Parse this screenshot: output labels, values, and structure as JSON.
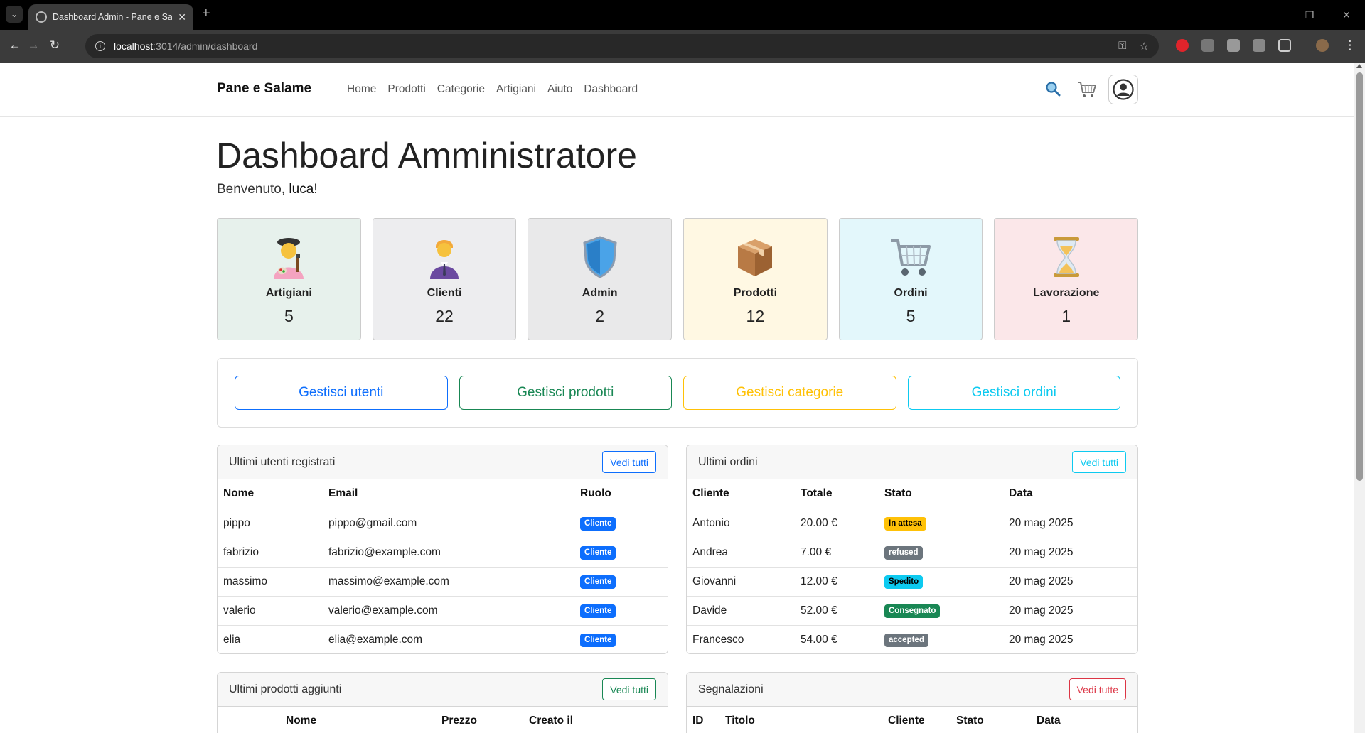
{
  "browser": {
    "tab_title": "Dashboard Admin - Pane e Salame",
    "url_host": "localhost",
    "url_path": ":3014/admin/dashboard"
  },
  "nav": {
    "brand": "Pane e Salame",
    "links": [
      "Home",
      "Prodotti",
      "Categorie",
      "Artigiani",
      "Aiuto",
      "Dashboard"
    ]
  },
  "page": {
    "title": "Dashboard Amministratore",
    "welcome_prefix": "Benvenuto, ",
    "username": "luca",
    "welcome_suffix": "!"
  },
  "stats": [
    {
      "label": "Artigiani",
      "value": "5",
      "icon": "artist-icon",
      "bg": "#e7f1ec"
    },
    {
      "label": "Clienti",
      "value": "22",
      "icon": "person-icon",
      "bg": "#ededef"
    },
    {
      "label": "Admin",
      "value": "2",
      "icon": "shield-icon",
      "bg": "#e9e9ea"
    },
    {
      "label": "Prodotti",
      "value": "12",
      "icon": "package-icon",
      "bg": "#fff8e3"
    },
    {
      "label": "Ordini",
      "value": "5",
      "icon": "cart-icon",
      "bg": "#e3f7fb"
    },
    {
      "label": "Lavorazione",
      "value": "1",
      "icon": "hourglass-icon",
      "bg": "#fbe7e9"
    }
  ],
  "actions": [
    {
      "label": "Gestisci utenti",
      "color": "#0d6efd"
    },
    {
      "label": "Gestisci prodotti",
      "color": "#198754"
    },
    {
      "label": "Gestisci categorie",
      "color": "#ffc107"
    },
    {
      "label": "Gestisci ordini",
      "color": "#0dcaf0"
    }
  ],
  "users_card": {
    "title": "Ultimi utenti registrati",
    "button": "Vedi tutti",
    "columns": [
      "Nome",
      "Email",
      "Ruolo"
    ],
    "rows": [
      [
        "pippo",
        "pippo@gmail.com",
        "Cliente"
      ],
      [
        "fabrizio",
        "fabrizio@example.com",
        "Cliente"
      ],
      [
        "massimo",
        "massimo@example.com",
        "Cliente"
      ],
      [
        "valerio",
        "valerio@example.com",
        "Cliente"
      ],
      [
        "elia",
        "elia@example.com",
        "Cliente"
      ]
    ],
    "role_color": "#0d6efd"
  },
  "orders_card": {
    "title": "Ultimi ordini",
    "button": "Vedi tutti",
    "columns": [
      "Cliente",
      "Totale",
      "Stato",
      "Data"
    ],
    "rows": [
      [
        "Antonio",
        "20.00 €",
        "In attesa",
        "20 mag 2025"
      ],
      [
        "Andrea",
        "7.00 €",
        "refused",
        "20 mag 2025"
      ],
      [
        "Giovanni",
        "12.00 €",
        "Spedito",
        "20 mag 2025"
      ],
      [
        "Davide",
        "52.00 €",
        "Consegnato",
        "20 mag 2025"
      ],
      [
        "Francesco",
        "54.00 €",
        "accepted",
        "20 mag 2025"
      ]
    ],
    "status_colors": [
      "#ffc107",
      "#6c757d",
      "#0dcaf0",
      "#198754",
      "#6c757d"
    ],
    "status_text_colors": [
      "#000000",
      "#ffffff",
      "#000000",
      "#ffffff",
      "#ffffff"
    ]
  },
  "products_card": {
    "title": "Ultimi prodotti aggiunti",
    "button": "Vedi tutti",
    "columns": [
      "Nome",
      "Prezzo",
      "Creato il"
    ]
  },
  "reports_card": {
    "title": "Segnalazioni",
    "button": "Vedi tutte",
    "columns": [
      "ID",
      "Titolo",
      "Cliente",
      "Stato",
      "Data"
    ]
  }
}
